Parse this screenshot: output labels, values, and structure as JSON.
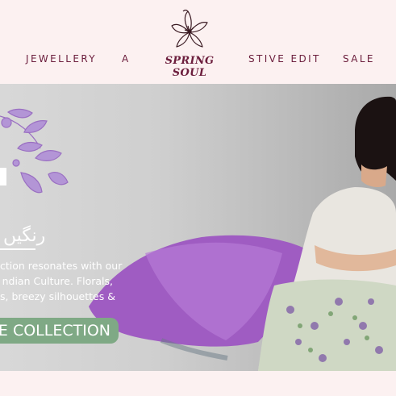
{
  "nav": {
    "items": [
      {
        "label": "JEWELLERY"
      },
      {
        "label": "A"
      },
      {
        "label": "STIVE EDIT"
      },
      {
        "label": "SALE"
      }
    ]
  },
  "logo": {
    "text": "SPRING SOUL",
    "icon": "lotus-flower-icon"
  },
  "banner": {
    "heading_urdu": "رنگیں",
    "description_lines": [
      "ction resonates with our",
      "ndian  Culture.  Florals,",
      "s,  breezy  silhouettes  &"
    ],
    "cta_label": "E COLLECTION"
  },
  "colors": {
    "brand": "#6b1d3c",
    "background": "#fcf1f1",
    "cta": "#7fa985",
    "lavender": "#9a6fc2"
  }
}
